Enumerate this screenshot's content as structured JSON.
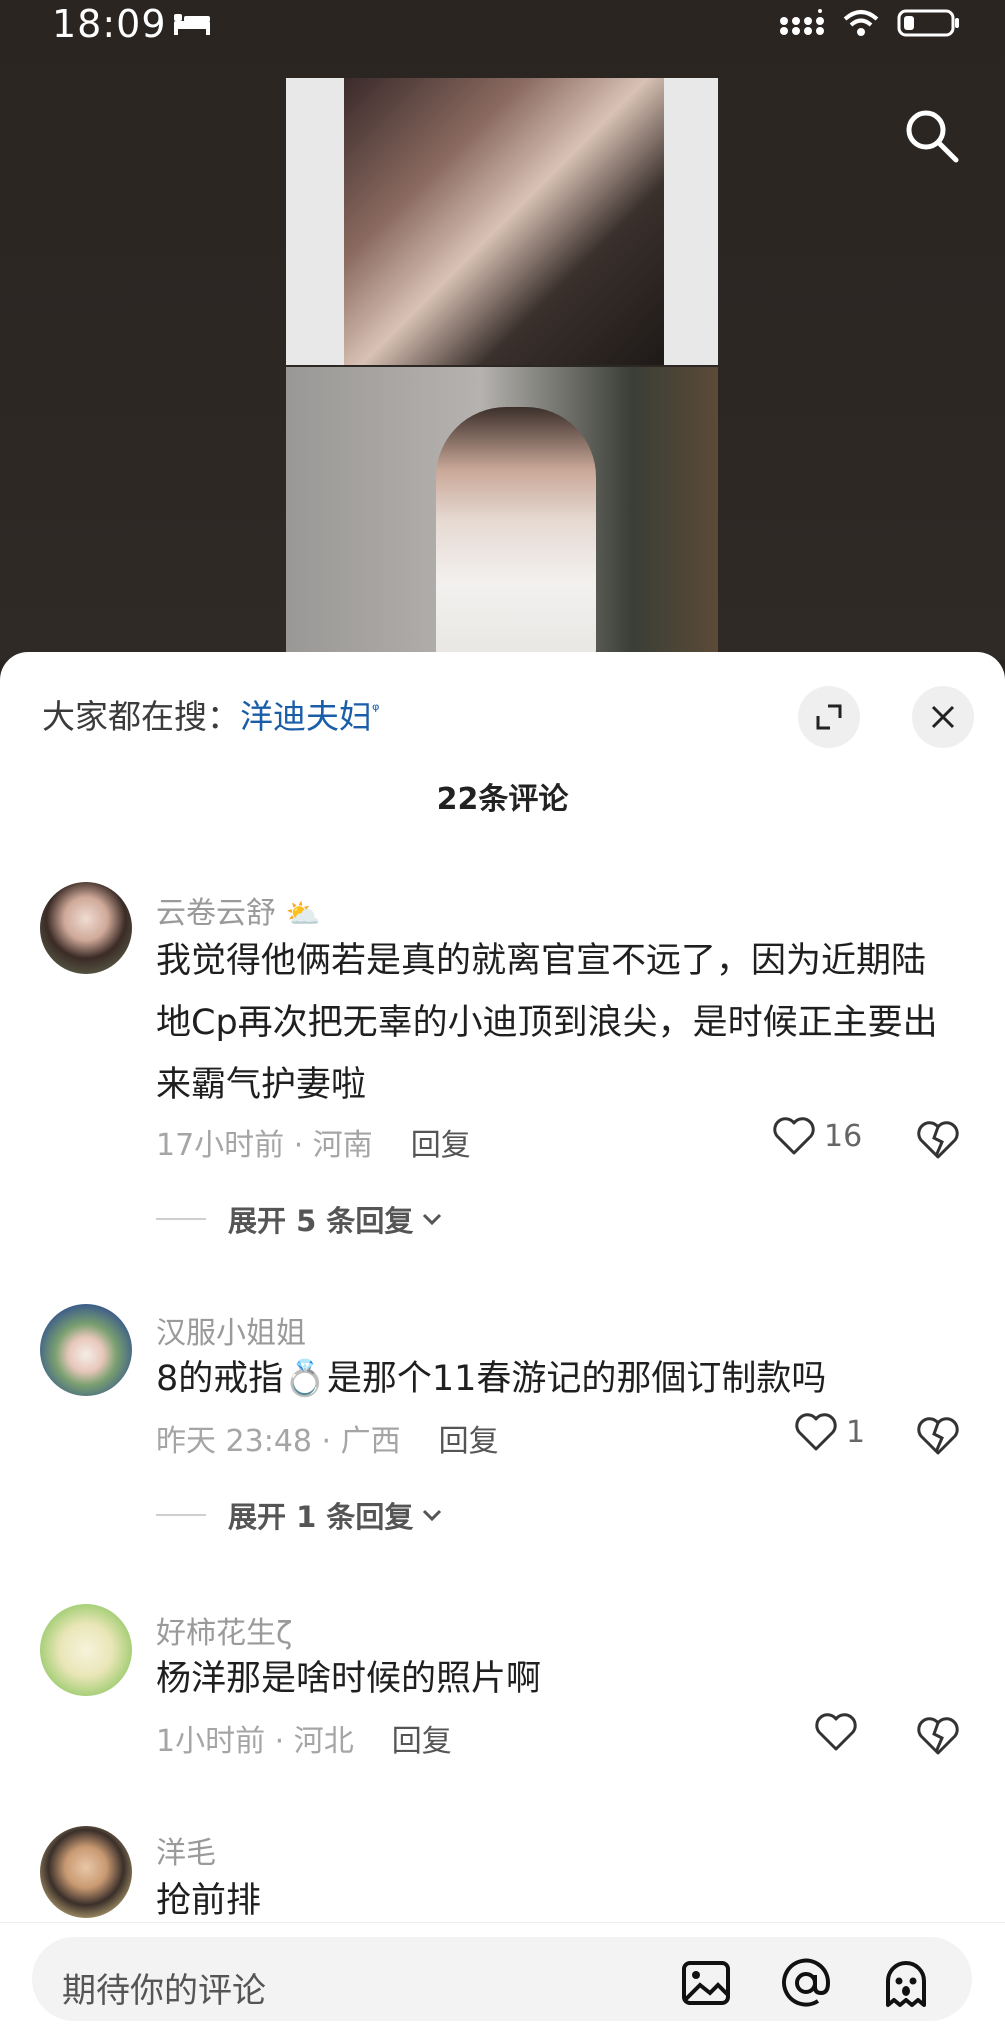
{
  "status": {
    "time": "18:09"
  },
  "hot_search": {
    "prefix": "大家都在搜：",
    "keyword": "洋迪夫妇",
    "keyword_icon": "ᵠ"
  },
  "comment_count": "22条评论",
  "comments": [
    {
      "name": "云卷云舒",
      "name_emoji": "⛅",
      "text": "我觉得他俩若是真的就离官宣不远了，因为近期陆地Cp再次把无辜的小迪顶到浪尖，是时候正主要出来霸气护妻啦",
      "time_loc": "17小时前 · 河南",
      "reply": "回复",
      "likes": "16",
      "expand": "展开 5 条回复"
    },
    {
      "name": "汉服小姐姐",
      "text_before": "8的戒指",
      "text_emoji": "💍",
      "text_after": "是那个11春游记的那個订制款吗",
      "time_loc": "昨天 23:48 · 广西",
      "reply": "回复",
      "likes": "1",
      "expand": "展开 1 条回复"
    },
    {
      "name": "好柿花生ζ",
      "text": "杨洋那是啥时候的照片啊",
      "time_loc": "1小时前 · 河北",
      "reply": "回复",
      "likes": ""
    },
    {
      "name": "洋毛",
      "text": "抢前排"
    }
  ],
  "input": {
    "placeholder": "期待你的评论"
  },
  "colors": {
    "link": "#1a5ea8",
    "background_top": "#2b2522"
  },
  "icons": [
    "search-icon",
    "expand-icon",
    "close-icon",
    "heart-icon",
    "broken-heart-icon",
    "image-icon",
    "at-icon",
    "emoji-icon"
  ]
}
